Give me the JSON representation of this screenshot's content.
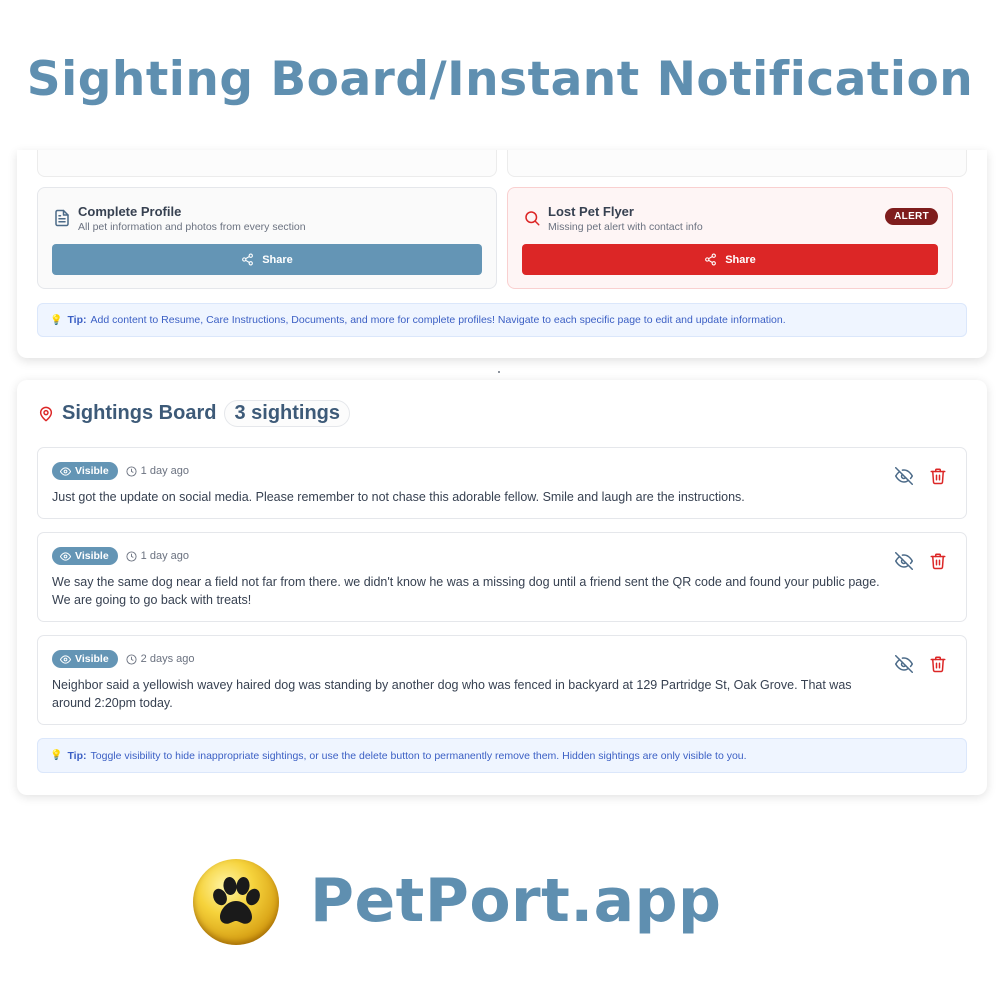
{
  "headline": "Sighting Board/Instant Notification",
  "share": {
    "profile": {
      "title": "Complete Profile",
      "subtitle": "All pet information and photos from every section",
      "button_label": "Share",
      "icon": "document-icon"
    },
    "flyer": {
      "title": "Lost Pet Flyer",
      "subtitle": "Missing pet alert with contact info",
      "badge": "ALERT",
      "button_label": "Share",
      "icon": "search-icon"
    },
    "tip": {
      "label": "Tip:",
      "text": "Add content to Resume, Care Instructions, Documents, and more for complete profiles! Navigate to each specific page to edit and update information."
    }
  },
  "board": {
    "title": "Sightings Board",
    "count": "3 sightings",
    "sightings": [
      {
        "status": "Visible",
        "time": "1 day ago",
        "message": "Just got the update on social media. Please remember to not chase this adorable fellow. Smile and laugh are the instructions."
      },
      {
        "status": "Visible",
        "time": "1 day ago",
        "message": "We say the same dog near a field not far from there. we didn't know he was a missing dog until a friend sent the QR code and found your public page. We are going to go back with treats!"
      },
      {
        "status": "Visible",
        "time": "2 days ago",
        "message": "Neighbor said a yellowish wavey haired dog was standing by another dog who was fenced in backyard at 129 Partridge St, Oak Grove. That was around 2:20pm today."
      }
    ],
    "tip": {
      "label": "Tip:",
      "text": "Toggle visibility to hide inappropriate sightings, or use the delete button to permanently remove them. Hidden sightings are only visible to you."
    }
  },
  "brand": {
    "name": "PetPort.app",
    "logo_icon": "paw-icon"
  },
  "colors": {
    "brand_blue": "#5f8fb0",
    "share_blue": "#6495b5",
    "alert_red": "#dc2626",
    "tip_text": "#3b5fc4"
  }
}
